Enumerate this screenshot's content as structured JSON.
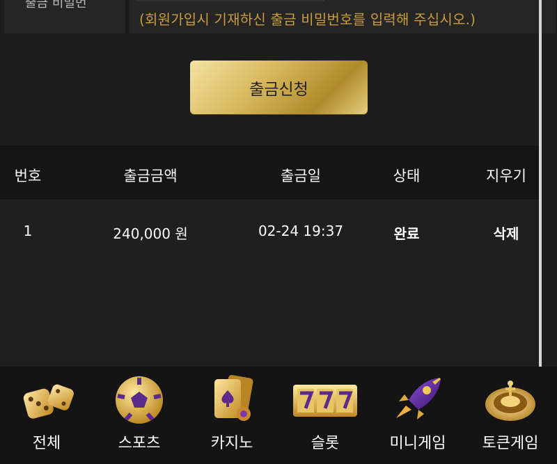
{
  "withdraw_form": {
    "label_partial": "출금 비밀번",
    "hint": "(회원가입시 기재하신 출금 비밀번호를 입력해 주십시오.)",
    "submit_label": "출금신청"
  },
  "table": {
    "headers": [
      "번호",
      "출금금액",
      "출금일",
      "상태",
      "지우기"
    ],
    "rows": [
      {
        "no": "1",
        "amount": "240,000 원",
        "date": "02-24 19:37",
        "status": "완료",
        "delete": "삭제"
      }
    ]
  },
  "bottom_nav": {
    "items": [
      {
        "label": "전체",
        "icon": "dice-icon"
      },
      {
        "label": "스포츠",
        "icon": "soccer-ball-icon"
      },
      {
        "label": "카지노",
        "icon": "playing-card-icon"
      },
      {
        "label": "슬롯",
        "icon": "slot-777-icon"
      },
      {
        "label": "미니게임",
        "icon": "rocket-icon"
      },
      {
        "label": "토큰게임",
        "icon": "roulette-icon"
      }
    ]
  },
  "colors": {
    "accent_gold": "#c89b3c",
    "background": "#1c1c1c"
  }
}
